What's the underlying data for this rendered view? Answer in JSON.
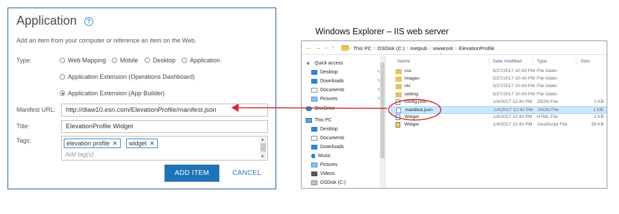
{
  "app": {
    "title": "Application",
    "description": "Add an item from your computer or reference an item on the Web.",
    "type_label": "Type:",
    "type_options": [
      {
        "label": "Web Mapping",
        "checked": false
      },
      {
        "label": "Mobile",
        "checked": false
      },
      {
        "label": "Desktop",
        "checked": false
      },
      {
        "label": "Application",
        "checked": false
      },
      {
        "label": "Application Extension (Operations Dashboard)",
        "checked": false
      },
      {
        "label": "Application Extension (App Builder)",
        "checked": true
      }
    ],
    "manifest_label": "Manifest URL:",
    "manifest_value": "http://dlaw10.esri.com/ElevationProfile/manifest.json",
    "title_label": "Title:",
    "title_value": "ElevationProfile Widget",
    "tags_label": "Tags:",
    "tags": [
      "elevation profile",
      "widget"
    ],
    "tags_placeholder": "Add tag(s)",
    "add_button": "ADD ITEM",
    "cancel_button": "CANCEL"
  },
  "caption": "Windows Explorer – IIS web server",
  "explorer": {
    "breadcrumb": [
      "This PC",
      "OSDisk (C:)",
      "inetpub",
      "wwwroot",
      "ElevationProfile"
    ],
    "nav": {
      "quick_access": "Quick access",
      "items": [
        "Desktop",
        "Downloads",
        "Documents",
        "Pictures",
        "OneDrive",
        "This PC",
        "Desktop",
        "Documents",
        "Downloads",
        "Music",
        "Pictures",
        "Videos",
        "OSDisk (C:)"
      ]
    },
    "columns": {
      "name": "Name",
      "date": "Date modified",
      "type": "Type",
      "size": "Size"
    },
    "files": [
      {
        "name": "css",
        "date": "5/27/2017 10:43 PM",
        "type": "File folder",
        "size": "",
        "icon": "folder"
      },
      {
        "name": "images",
        "date": "5/27/2017 10:43 PM",
        "type": "File folder",
        "size": "",
        "icon": "folder"
      },
      {
        "name": "nls",
        "date": "5/27/2017 10:43 PM",
        "type": "File folder",
        "size": "",
        "icon": "folder"
      },
      {
        "name": "setting",
        "date": "5/27/2017 10:43 PM",
        "type": "File folder",
        "size": "",
        "icon": "folder"
      },
      {
        "name": "config.json",
        "date": "1/4/2017 12:40 PM",
        "type": "JSON File",
        "size": "1 KB",
        "icon": "file"
      },
      {
        "name": "manifest.json",
        "date": "1/4/2017 12:40 PM",
        "type": "JSON File",
        "size": "1 KB",
        "icon": "file",
        "selected": true
      },
      {
        "name": "Widget",
        "date": "1/4/2017 12:40 PM",
        "type": "HTML File",
        "size": "2 KB",
        "icon": "html"
      },
      {
        "name": "Widget",
        "date": "1/4/2017 12:40 PM",
        "type": "JavaScript File",
        "size": "39 KB",
        "icon": "js"
      }
    ]
  },
  "annotation": {
    "color": "#d9262b"
  }
}
